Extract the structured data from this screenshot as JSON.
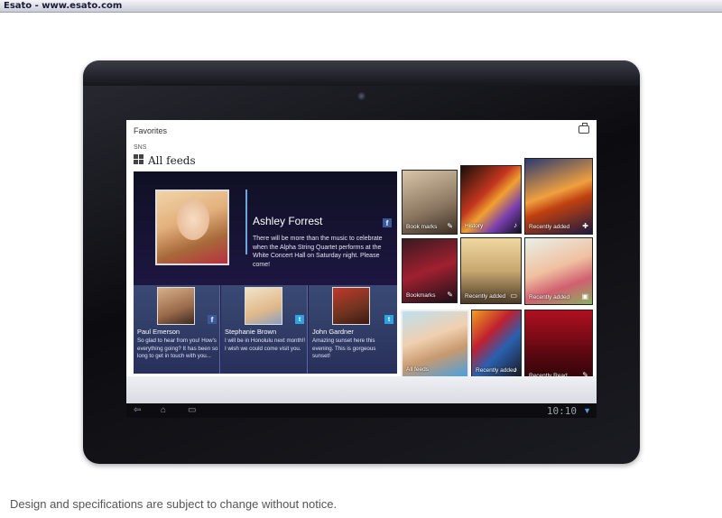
{
  "site": {
    "label": "Esato - www.esato.com"
  },
  "screen": {
    "title": "Favorites",
    "section": "SNS",
    "heading": "All feeds"
  },
  "featured": {
    "name": "Ashley Forrest",
    "message": "There will be more than the music to celebrate when the Alpha String Quartet performs at the White Concert Hall on Saturday night. Please come!",
    "network_icon": "facebook-icon"
  },
  "cards": [
    {
      "name": "Paul Emerson",
      "message": "So glad to hear from you! How's everything going? It has been so long to get in touch with you...",
      "network_icon": "facebook-icon"
    },
    {
      "name": "Stephanie Brown",
      "message": "I will be in Honolulu next month!! I wish we could come visit you.",
      "network_icon": "twitter-icon"
    },
    {
      "name": "John Gardner",
      "message": "Amazing sunset here this evening. This is gorgeous sunset!",
      "network_icon": "twitter-icon"
    }
  ],
  "tiles": [
    {
      "label": "Book marks"
    },
    {
      "label": "History"
    },
    {
      "label": "Recently added"
    },
    {
      "label": "Bookmarks"
    },
    {
      "label": "Recently added"
    },
    {
      "label": "Recently added"
    },
    {
      "label": "All feeds"
    },
    {
      "label": "Recently added"
    },
    {
      "label": "Recently Read"
    }
  ],
  "status": {
    "time": "10:10"
  },
  "footer": {
    "disclaimer": "Design and specifications are subject to change without notice."
  },
  "colors": {
    "accent": "#4aa0e0",
    "facebook": "#3b5998",
    "twitter": "#2fa2e0"
  }
}
